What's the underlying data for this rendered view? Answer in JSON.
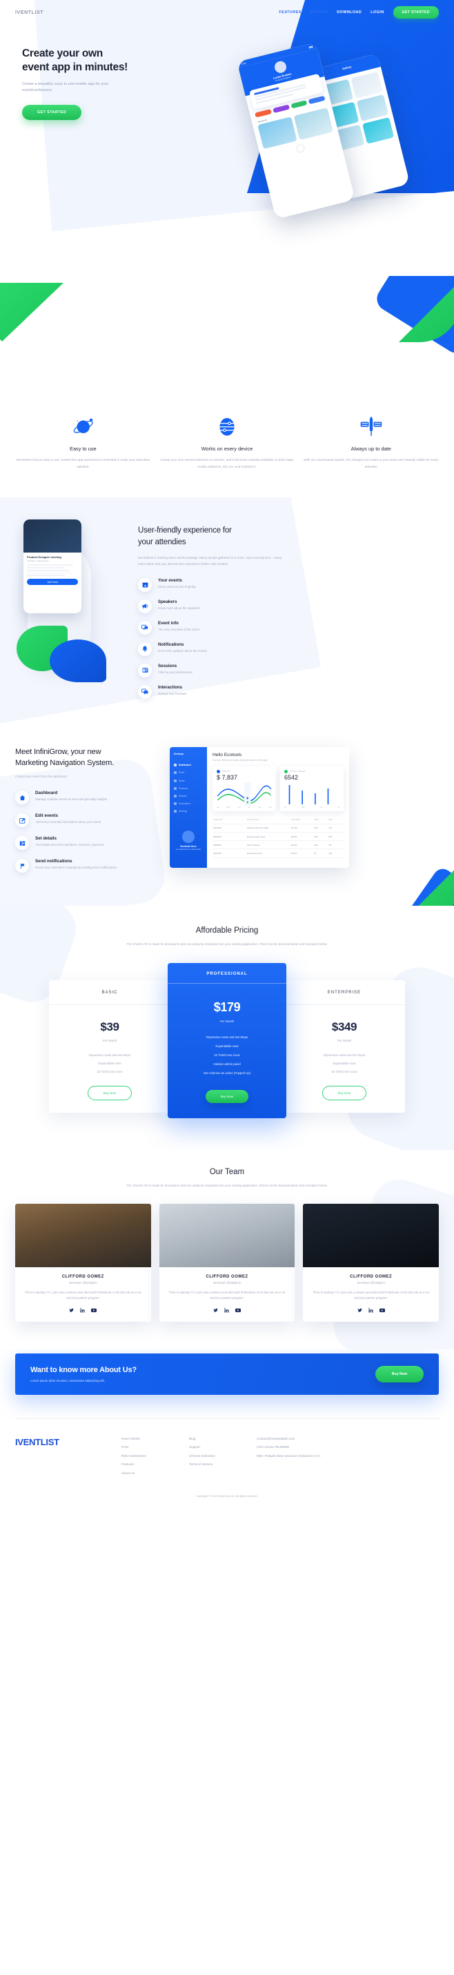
{
  "brand": "IVENTLIST",
  "nav": {
    "links": [
      {
        "label": "FEATURES",
        "on_blue": false
      },
      {
        "label": "PRICING",
        "on_blue": false
      },
      {
        "label": "DOWNLOAD",
        "on_blue": true
      },
      {
        "label": "LOGIN",
        "on_blue": true
      }
    ],
    "cta": "GET STARTED"
  },
  "hero": {
    "title_line1": "Create your own",
    "title_line2": "event app in minutes!",
    "subtitle": "Create a beautiful, easy to use mobile app for your event/conference",
    "cta": "GET STARTED",
    "phone_a": {
      "status_time": "9:41",
      "status_right": "▮▮▮",
      "user_name": "Lucas Braams",
      "user_role": "Product Designer",
      "section_label": "Moments",
      "chips": [
        "Movie",
        "Music",
        "Photo",
        "Event"
      ]
    },
    "phone_b": {
      "header": "Gallery"
    }
  },
  "features3": [
    {
      "icon": "planet-icon",
      "title": "Easy to use",
      "body": "We believe that an easy to use, hussle-free app experience is essential to make your attendees satisfied."
    },
    {
      "icon": "globe-icon",
      "title": "Works on every device",
      "body": "Create your own event/conference in minutes, and it becomes instantly available on both major mobile platforms, iOS 10+ and Android 5+"
    },
    {
      "icon": "satellite-icon",
      "title": "Always up to date",
      "body": "With our cloud-based system, the changes you make to your event are instantly visible for every attendee"
    }
  ],
  "userfriendly": {
    "title_line1": "User-friendly experience for",
    "title_line2": "your attendies",
    "paragraph": "We believe in sharing ideas and knowledge. Many people gathered in a room, and a microphone – every event starts that way. Elevate this experience further with iventlist.",
    "items": [
      {
        "icon": "calendar-icon",
        "title": "Your events",
        "subtitle": "Every event at your fingertip"
      },
      {
        "icon": "megaphone-icon",
        "title": "Speakers",
        "subtitle": "Know more about the speakers"
      },
      {
        "icon": "monitor-icon",
        "title": "Event info",
        "subtitle": "The very essential of the event"
      },
      {
        "icon": "bell-icon",
        "title": "Notifications",
        "subtitle": "Don't miss updates about the events"
      },
      {
        "icon": "list-icon",
        "title": "Sessions",
        "subtitle": "Filter by your preferences"
      },
      {
        "icon": "chat-icon",
        "title": "Interactions",
        "subtitle": "Ratings and Reviews"
      }
    ],
    "phone_card": {
      "title": "Product Designer meeting",
      "meta": "Yuri Dav · Lorem ipsum",
      "button": "Join Event"
    }
  },
  "infinigrow": {
    "title_line1": "Meet InfiniGrow, your new",
    "title_line2": "Marketing Navigation System.",
    "paragraph": "Control your event from the dashboard",
    "items": [
      {
        "icon": "home-icon",
        "title": "Dashboard",
        "subtitle": "Manage multiple events at once and get daily insights"
      },
      {
        "icon": "edit-icon",
        "title": "Edit events",
        "subtitle": "Add every essential information about your event"
      },
      {
        "icon": "details-icon",
        "title": "Set details",
        "subtitle": "Add details about the speakers, sessions, sponsors"
      },
      {
        "icon": "flag-icon",
        "title": "Send notifications",
        "subtitle": "Reach your attendees instantly by sending them notifications"
      }
    ],
    "dashboard": {
      "brand": "Drshop",
      "nav": [
        "Dashboard",
        "Profit",
        "Sales",
        "Products",
        "Reports",
        "Employees",
        "Settings"
      ],
      "active_nav": "Dashboard",
      "user_name": "Ecotools Ours",
      "user_role": "Live Beautiful Live Beautifully",
      "greeting": "Hello Ecotools",
      "greeting_sub": "You can check your recaps about your sales in this page",
      "profit_label": "PROFIT",
      "profit_value": "$ 7,837",
      "sales_label": "TOTAL SALES",
      "sales_value": "6542",
      "months": [
        "Apr",
        "May",
        "Jun",
        "Jul",
        "Aug",
        "Sep"
      ],
      "table_headers": [
        "Product ID",
        "Product Name",
        "Total View",
        "Price",
        "Sold"
      ],
      "table_rows": [
        [
          "04W1282",
          "Sepatu Setap Non Capat",
          "93,729",
          "$16",
          "764"
        ],
        [
          "08W2475",
          "Masa Ipi Sagor Tetori",
          "86,652",
          "$18",
          "625"
        ],
        [
          "04W8497",
          "Kacur Terbang",
          "52,093",
          "$20",
          "711"
        ],
        [
          "04W7460",
          "Enaton Boot Koto",
          "45,621",
          "$7",
          "162"
        ]
      ]
    }
  },
  "pricing": {
    "title": "Affordable Pricing",
    "subtitle": "The Checks API is made for developers and can easily be integrated into your existing application. Check out the documentation and examples below.",
    "plans": [
      {
        "name": "BASIC",
        "price": "$39",
        "per": "Per Month",
        "features": [
          "Reponsive mode and Set Steps",
          "Expandable rows",
          "42 Tick/Cross icons"
        ],
        "button": "Buy Now",
        "featured": false
      },
      {
        "name": "PROFESSIONAL",
        "price": "$179",
        "per": "Per Month",
        "features": [
          "Reponsive mode and Set Steps",
          "Expandable rows",
          "42 Tick/Cross icons",
          "Intuitive admin panel",
          "Set Columns as active (Popped Up)"
        ],
        "button": "Buy Now",
        "featured": true
      },
      {
        "name": "ENTERPRISE",
        "price": "$349",
        "per": "Per Month",
        "features": [
          "Reponsive mode and Set Steps",
          "Expandable rows",
          "42 Tick/Cross icons"
        ],
        "button": "Buy Now",
        "featured": false
      }
    ]
  },
  "team": {
    "title": "Our Team",
    "subtitle": "The Checks API is made for developers and can easily be integrated into your existing application. Check out the documentation and examples below.",
    "members": [
      {
        "name": "CLIFFORD GOMEZ",
        "role": "Developer @indiajhon",
        "quote": "\"Prior to starting YYY, john was a sixteen year Microsoft Profesional. in his last role as a US Services partner program\"",
        "socials": [
          "twitter-icon",
          "linkedin-icon",
          "youtube-icon"
        ]
      },
      {
        "name": "CLIFFORD GOMEZ",
        "role": "Developer @indiajhon",
        "quote": "\"Prior to starting YYY, john was a sixteen year Microsoft Profesional. in his last role as a US Services partner program\"",
        "socials": [
          "twitter-icon",
          "linkedin-icon",
          "youtube-icon"
        ]
      },
      {
        "name": "CLIFFORD GOMEZ",
        "role": "Developer @indiajhon",
        "quote": "\"Prior to starting YYY, john was a sixteen year Microsoft Profesional. in his last role as a US Services partner program\"",
        "socials": [
          "twitter-icon",
          "linkedin-icon",
          "youtube-icon"
        ]
      }
    ]
  },
  "cta": {
    "title": "Want to know more About Us?",
    "subtitle": "Lorem ipsum dolor sit amet, consectetur adipisicing elit,",
    "button": "Buy Now"
  },
  "footer": {
    "logo": "IVENTLIST",
    "col1": [
      "How it Works",
      "Price",
      "Risk Assessment",
      "Features",
      "About Us"
    ],
    "col2": [
      "Blog",
      "Support",
      "Chrome Extension",
      "Terms of Service"
    ],
    "col3": [
      "Contact@meetpaladin.com",
      "CDI License #0L8599S",
      "DBA: Paladin Data Insurance Solutions in CA"
    ],
    "copyright": "Copyright © 2018 InfiniGrow Ltd. All rights reserved."
  },
  "colors": {
    "brand_blue": "#1463f3",
    "accent_green": "#22c55e",
    "text_dark": "#1d2030",
    "text_muted": "#a4abbd",
    "bg_light": "#f1f5fd"
  }
}
